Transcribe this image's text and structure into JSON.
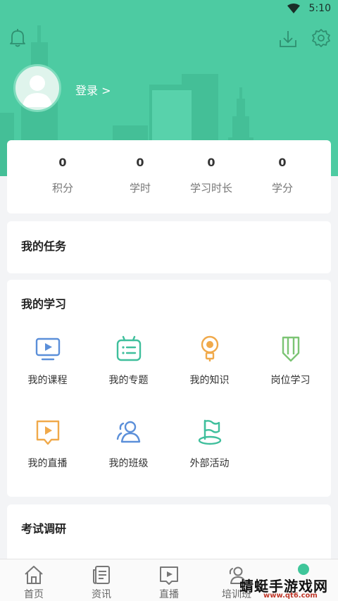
{
  "status_bar": {
    "time": "5:10"
  },
  "header": {
    "login_label": "登录 >"
  },
  "stats": [
    {
      "value": "0",
      "label": "积分"
    },
    {
      "value": "0",
      "label": "学时"
    },
    {
      "value": "0",
      "label": "学习时长"
    },
    {
      "value": "0",
      "label": "学分"
    }
  ],
  "tasks": {
    "title": "我的任务"
  },
  "study": {
    "title": "我的学习",
    "items": [
      {
        "label": "我的课程",
        "icon": "video-screen-icon",
        "color": "#5b8fd9"
      },
      {
        "label": "我的专题",
        "icon": "topic-list-icon",
        "color": "#3fbf9c"
      },
      {
        "label": "我的知识",
        "icon": "lightbulb-icon",
        "color": "#f0a94a"
      },
      {
        "label": "岗位学习",
        "icon": "pencil-icon",
        "color": "#7cc474"
      },
      {
        "label": "我的直播",
        "icon": "live-book-icon",
        "color": "#f0a94a"
      },
      {
        "label": "我的班级",
        "icon": "class-users-icon",
        "color": "#5b8fd9"
      },
      {
        "label": "外部活动",
        "icon": "flag-icon",
        "color": "#3fbf9c"
      }
    ]
  },
  "exam": {
    "title": "考试调研"
  },
  "bottom_nav": [
    {
      "label": "首页",
      "icon": "home-icon"
    },
    {
      "label": "资讯",
      "icon": "news-icon"
    },
    {
      "label": "直播",
      "icon": "live-icon"
    },
    {
      "label": "培训班",
      "icon": "training-icon"
    },
    {
      "label": "",
      "icon": "profile-icon"
    }
  ],
  "watermark": {
    "text": "蜻蜓手游戏网",
    "url": "www.qt6.com"
  },
  "colors": {
    "accent": "#4dcba2",
    "background": "#f3f4f6"
  }
}
